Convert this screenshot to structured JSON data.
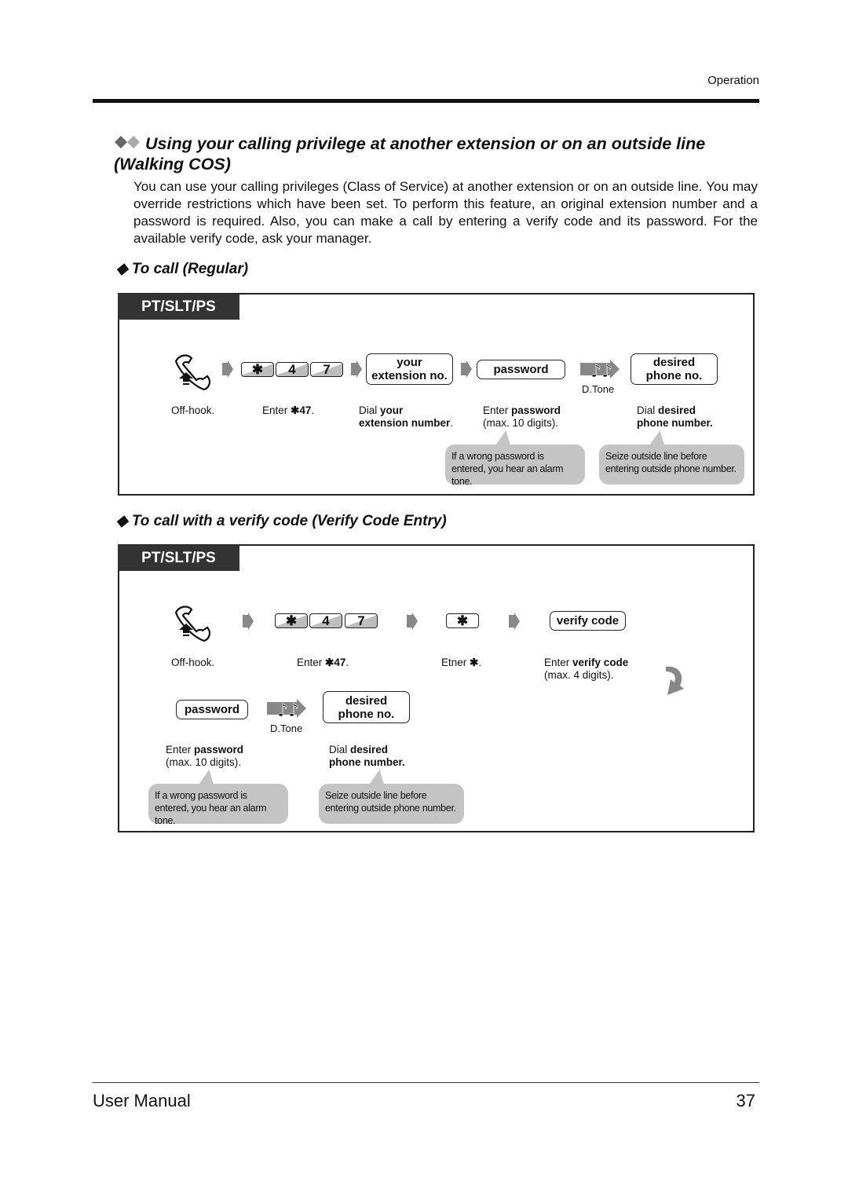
{
  "header": {
    "section": "Operation"
  },
  "title": {
    "line1": "Using your calling privilege at another extension or on an outside line",
    "line2": "(Walking COS)"
  },
  "intro": "You can use your calling privileges (Class of Service) at another extension or on an outside line. You may override restrictions which have been set. To perform this feature, an original extension number and a password is required. Also, you can make a call by entering a verify code and its password. For the available verify code, ask your manager.",
  "regular": {
    "heading": "To call (Regular)",
    "tab": "PT/SLT/PS",
    "keys": [
      "✱",
      "4",
      "7"
    ],
    "ext_box": [
      "your",
      "extension no."
    ],
    "password_box": "password",
    "tone": "D.Tone",
    "desired_box": [
      "desired",
      "phone no."
    ],
    "labels": {
      "offhook": "Off-hook.",
      "enter": "Enter ",
      "enter_code": "✱47",
      ".": ".",
      "dial": "Dial ",
      "your": "your",
      "ext_number": "extension number",
      "enter_pw": "Enter ",
      "password": "password",
      "max10": "(max. 10 digits).",
      "dial2": "Dial ",
      "desired": "desired",
      "phone_number": "phone number."
    },
    "bubbles": [
      "If a wrong password is entered, you hear an alarm tone.",
      "Seize outside line before entering outside phone number."
    ]
  },
  "verify": {
    "heading": "To call with a verify code (Verify Code Entry)",
    "tab": "PT/SLT/PS",
    "keys": [
      "✱",
      "4",
      "7"
    ],
    "star_key": "✱",
    "verify_box": "verify code",
    "password_box": "password",
    "tone": "D.Tone",
    "desired_box": [
      "desired",
      "phone no."
    ],
    "labels": {
      "offhook": "Off-hook.",
      "enter": "Enter ",
      "enter_code": "✱47",
      "etner": "Etner ",
      "star": "✱",
      "enter_v": "Enter ",
      "verify_code": "verify code",
      "max4": "(max. 4 digits).",
      "enter_pw": "Enter ",
      "password": "password",
      "max10": "(max. 10 digits).",
      "dial": "Dial ",
      "desired": "desired",
      "phone_number": "phone number."
    },
    "bubbles": [
      "If a wrong password is entered, you hear an alarm tone.",
      "Seize outside line before entering outside phone number."
    ]
  },
  "footer": {
    "title": "User Manual",
    "page": "37"
  }
}
